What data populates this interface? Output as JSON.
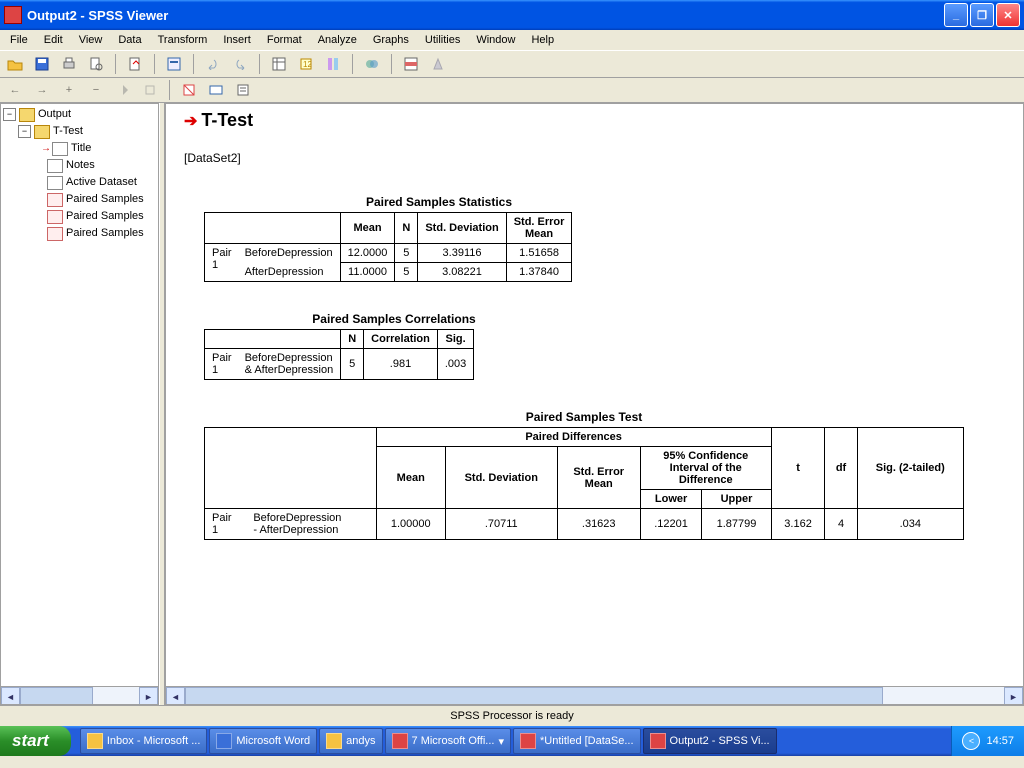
{
  "window": {
    "title": "Output2 - SPSS Viewer"
  },
  "menubar": [
    "File",
    "Edit",
    "View",
    "Data",
    "Transform",
    "Insert",
    "Format",
    "Analyze",
    "Graphs",
    "Utilities",
    "Window",
    "Help"
  ],
  "tree": {
    "root": "Output",
    "group": "T-Test",
    "items": [
      "Title",
      "Notes",
      "Active Dataset",
      "Paired Samples",
      "Paired Samples",
      "Paired Samples"
    ]
  },
  "content": {
    "heading": "T-Test",
    "dataset": "[DataSet2]",
    "table1": {
      "title": "Paired Samples Statistics",
      "cols": [
        "Mean",
        "N",
        "Std. Deviation",
        "Std. Error Mean"
      ],
      "pair_label": "Pair 1",
      "rows": [
        {
          "name": "BeforeDepression",
          "mean": "12.0000",
          "n": "5",
          "sd": "3.39116",
          "se": "1.51658"
        },
        {
          "name": "AfterDepression",
          "mean": "11.0000",
          "n": "5",
          "sd": "3.08221",
          "se": "1.37840"
        }
      ]
    },
    "table2": {
      "title": "Paired Samples Correlations",
      "cols": [
        "N",
        "Correlation",
        "Sig."
      ],
      "pair_label": "Pair 1",
      "row_name": "BeforeDepression & AfterDepression",
      "n": "5",
      "corr": ".981",
      "sig": ".003"
    },
    "table3": {
      "title": "Paired Samples Test",
      "group_hdr": "Paired Differences",
      "ci_hdr": "95% Confidence Interval of the Difference",
      "cols": [
        "Mean",
        "Std. Deviation",
        "Std. Error Mean",
        "Lower",
        "Upper",
        "t",
        "df",
        "Sig. (2-tailed)"
      ],
      "pair_label": "Pair 1",
      "row_name": "BeforeDepression - AfterDepression",
      "vals": [
        "1.00000",
        ".70711",
        ".31623",
        ".12201",
        "1.87799",
        "3.162",
        "4",
        ".034"
      ]
    }
  },
  "status": "SPSS Processor is ready",
  "taskbar": {
    "start": "start",
    "items": [
      {
        "label": "Inbox - Microsoft ...",
        "color": "#f5c242"
      },
      {
        "label": "Microsoft Word",
        "color": "#3a6fd8"
      },
      {
        "label": "andys",
        "color": "#f5c242"
      },
      {
        "label": "7 Microsoft Offi...",
        "color": "#d44",
        "dropdown": true
      },
      {
        "label": "*Untitled [DataSe...",
        "color": "#d44"
      },
      {
        "label": "Output2 - SPSS Vi...",
        "color": "#d44",
        "active": true
      }
    ],
    "clock": "14:57"
  }
}
